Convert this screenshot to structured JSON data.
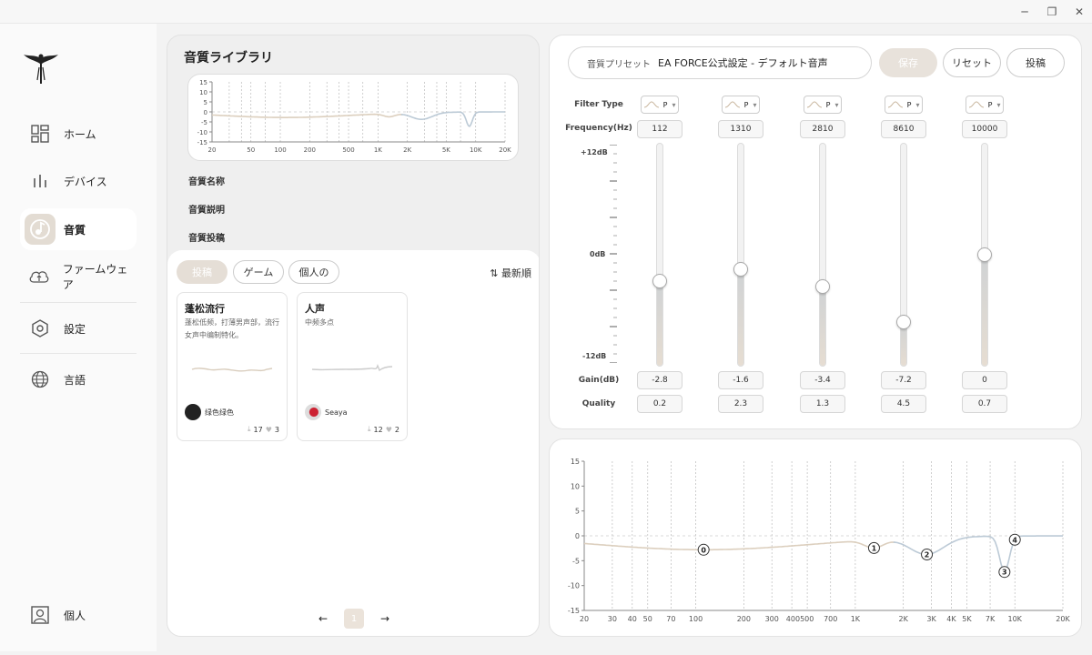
{
  "window": {
    "minimize_icon": "minimize-icon",
    "restore_icon": "restore-icon",
    "close_icon": "close-icon"
  },
  "sidebar": {
    "items": [
      {
        "label": "ホーム",
        "icon": "dashboard-icon"
      },
      {
        "label": "デバイス",
        "icon": "bars-icon"
      },
      {
        "label": "音質",
        "icon": "music-note-icon"
      },
      {
        "label": "ファームウェア",
        "icon": "cloud-upload-icon"
      },
      {
        "label": "設定",
        "icon": "hexagon-icon"
      },
      {
        "label": "言語",
        "icon": "globe-icon"
      },
      {
        "label": "個人",
        "icon": "user-icon"
      }
    ]
  },
  "library": {
    "title": "音質ライブラリ",
    "fields": [
      "音質名称",
      "音質説明",
      "音質投稿"
    ],
    "tabs": [
      "投稿",
      "ゲーム",
      "個人の"
    ],
    "sort_label": "⇅ 最新順",
    "cards": [
      {
        "title": "蓬松流行",
        "desc": "蓬松低频，打薄男声部，流行女声中编制特化。",
        "user": "绿色绿色",
        "downloads": "17",
        "likes": "3"
      },
      {
        "title": "人声",
        "desc": "中频多点",
        "user": "Seaya",
        "downloads": "12",
        "likes": "2"
      }
    ],
    "pager": {
      "prev": "←",
      "page": "1",
      "next": "→"
    }
  },
  "eq": {
    "preset_label": "音質プリセット",
    "preset_name": "EA FORCE公式設定 - デフォルト音声",
    "save_label": "保存",
    "reset_label": "リセット",
    "post_label": "投稿",
    "rows": {
      "filter_type": "Filter Type",
      "frequency": "Frequency(Hz)",
      "gain": "Gain(dB)",
      "quality": "Quality"
    },
    "db_top": "+12dB",
    "db_mid": "0dB",
    "db_bottom": "-12dB",
    "bands": [
      {
        "type": "P",
        "freq": "112",
        "gain": "-2.8",
        "q": "0.2"
      },
      {
        "type": "P",
        "freq": "1310",
        "gain": "-1.6",
        "q": "2.3"
      },
      {
        "type": "P",
        "freq": "2810",
        "gain": "-3.4",
        "q": "1.3"
      },
      {
        "type": "P",
        "freq": "8610",
        "gain": "-7.2",
        "q": "4.5"
      },
      {
        "type": "P",
        "freq": "10000",
        "gain": "0",
        "q": "0.7"
      }
    ],
    "slider_levels_db": [
      -2.8,
      -1.6,
      -3.4,
      -7.2,
      0
    ]
  },
  "curve": {
    "y_ticks": [
      "15",
      "10",
      "5",
      "0",
      "-5",
      "-10",
      "-15"
    ],
    "x_ticks": [
      "20",
      "30",
      "40",
      "50",
      "70",
      "100",
      "200",
      "300",
      "400500",
      "700",
      "1K",
      "2K",
      "3K",
      "4K",
      "5K",
      "7K",
      "10K",
      "20K"
    ],
    "mini_x_ticks": [
      "20",
      "50",
      "100",
      "200",
      "500",
      "1K",
      "2K",
      "5K",
      "10K",
      "20K"
    ],
    "nodes": [
      "0",
      "1",
      "2",
      "3",
      "4"
    ]
  }
}
